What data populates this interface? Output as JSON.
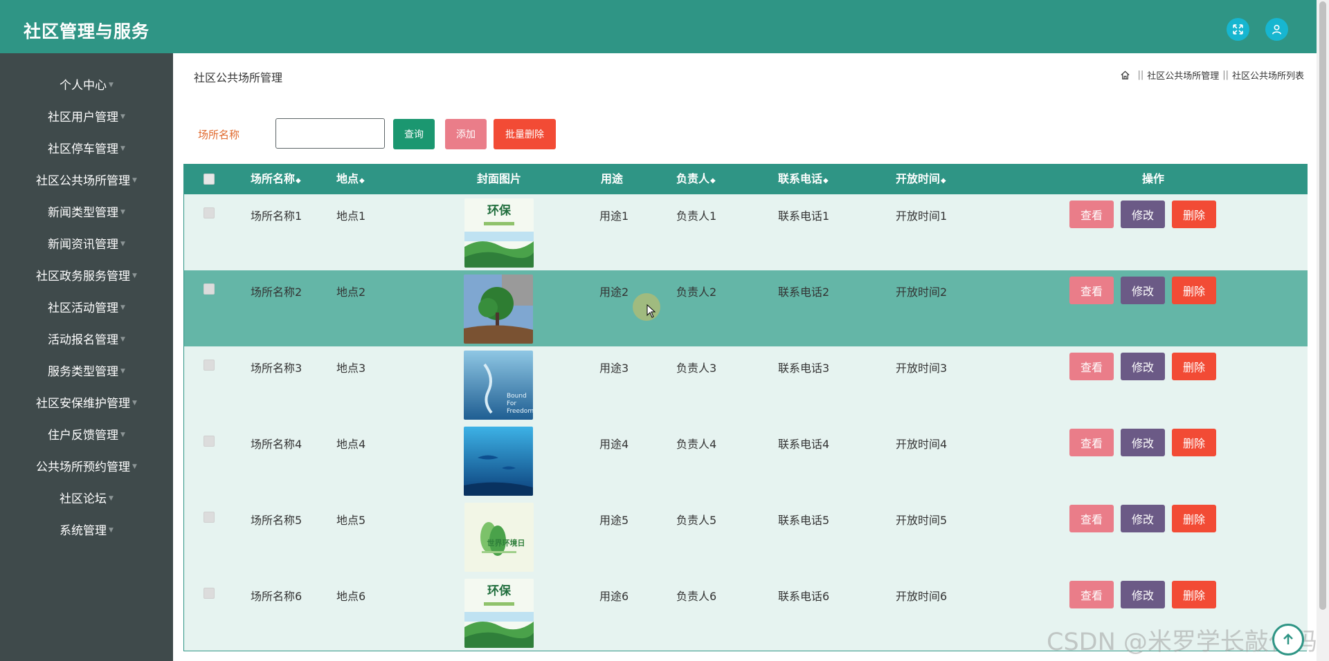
{
  "header": {
    "title": "社区管理与服务",
    "fullscreen_icon": "fullscreen-icon",
    "user_icon": "user-icon"
  },
  "sidebar": {
    "items": [
      {
        "label": "个人中心"
      },
      {
        "label": "社区用户管理"
      },
      {
        "label": "社区停车管理"
      },
      {
        "label": "社区公共场所管理"
      },
      {
        "label": "新闻类型管理"
      },
      {
        "label": "新闻资讯管理"
      },
      {
        "label": "社区政务服务管理"
      },
      {
        "label": "社区活动管理"
      },
      {
        "label": "活动报名管理"
      },
      {
        "label": "服务类型管理"
      },
      {
        "label": "社区安保维护管理"
      },
      {
        "label": "住户反馈管理"
      },
      {
        "label": "公共场所预约管理"
      },
      {
        "label": "社区论坛"
      },
      {
        "label": "系统管理"
      }
    ]
  },
  "page": {
    "heading": "社区公共场所管理",
    "breadcrumb": [
      "社区公共场所管理",
      "社区公共场所列表"
    ],
    "breadcrumb_sep": "||"
  },
  "filter": {
    "label": "场所名称",
    "value": "",
    "query_label": "查询",
    "add_label": "添加",
    "batch_delete_label": "批量删除"
  },
  "table": {
    "columns": [
      "场所名称",
      "地点",
      "封面图片",
      "用途",
      "负责人",
      "联系电话",
      "开放时间",
      "操作"
    ],
    "sort_glyph": "◆",
    "rows": [
      {
        "name": "场所名称1",
        "location": "地点1",
        "cover": "环保海报",
        "purpose": "用途1",
        "manager": "负责人1",
        "phone": "联系电话1",
        "open_time": "开放时间1"
      },
      {
        "name": "场所名称2",
        "location": "地点2",
        "cover": "大树图片",
        "purpose": "用途2",
        "manager": "负责人2",
        "phone": "联系电话2",
        "open_time": "开放时间2"
      },
      {
        "name": "场所名称3",
        "location": "地点3",
        "cover": "Bound For Freedom",
        "purpose": "用途3",
        "manager": "负责人3",
        "phone": "联系电话3",
        "open_time": "开放时间3"
      },
      {
        "name": "场所名称4",
        "location": "地点4",
        "cover": "海洋图片",
        "purpose": "用途4",
        "manager": "负责人4",
        "phone": "联系电话4",
        "open_time": "开放时间4"
      },
      {
        "name": "场所名称5",
        "location": "地点5",
        "cover": "世界环境日",
        "purpose": "用途5",
        "manager": "负责人5",
        "phone": "联系电话5",
        "open_time": "开放时间5"
      },
      {
        "name": "场所名称6",
        "location": "地点6",
        "cover": "环保海报",
        "purpose": "用途6",
        "manager": "负责人6",
        "phone": "联系电话6",
        "open_time": "开放时间6"
      }
    ],
    "actions": {
      "view": "查看",
      "edit": "修改",
      "delete": "删除"
    },
    "cover_texts": {
      "env": "环保",
      "bound": "Bound For Freedom",
      "world_env": "世界环境日"
    }
  },
  "colors": {
    "header": "#2f9585",
    "sidebar": "#3f4a4b",
    "view": "#ea7d89",
    "edit": "#6b5a86",
    "delete": "#f24b35",
    "query": "#1b9770"
  },
  "watermark": "CSDN @米罗学长敲代码"
}
